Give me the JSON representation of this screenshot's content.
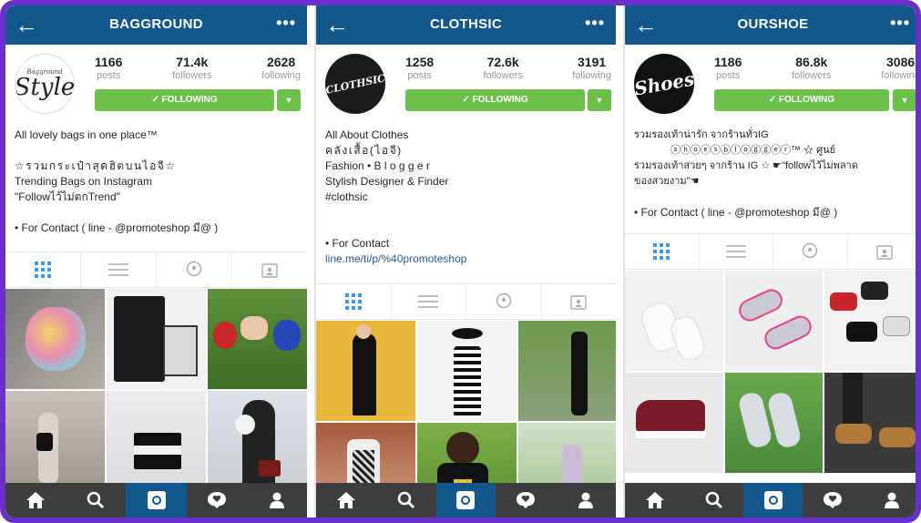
{
  "profiles": [
    {
      "title": "BAGGROUND",
      "posts": "1166",
      "posts_label": "posts",
      "followers": "71.4k",
      "followers_label": "followers",
      "following": "2628",
      "following_label": "following",
      "follow_button": "✓ FOLLOWING",
      "avatar_small": "Bagground",
      "avatar_text": "Style",
      "bio": [
        "All lovely bags in one place™",
        "",
        "☆รวมกระเป๋าสุดฮิตบนไอจี☆",
        "Trending Bags on Instagram",
        "\"Followไว้ไม่ตกTrend\"",
        "",
        "• For Contact ( line - @promoteshop มี@ )"
      ]
    },
    {
      "title": "CLOTHSIC",
      "posts": "1258",
      "posts_label": "posts",
      "followers": "72.6k",
      "followers_label": "followers",
      "following": "3191",
      "following_label": "following",
      "follow_button": "✓ FOLLOWING",
      "avatar_text": "CLOTHSIC",
      "bio": [
        "All About Clothes",
        "คลังเสื้อ(ไอจี)",
        "Fashion • B l o g g e r",
        "Stylish Designer & Finder",
        "#clothsic",
        "",
        "",
        "• For Contact"
      ],
      "bio_link": "line.me/ti/p/%40promoteshop"
    },
    {
      "title": "OURSHOE",
      "posts": "1186",
      "posts_label": "posts",
      "followers": "86.8k",
      "followers_label": "followers",
      "following": "3086",
      "following_label": "following",
      "follow_button": "✓ FOLLOWING",
      "avatar_text": "Shoes",
      "bio": [
        "รวมรองเท้าน่ารัก จากร้านทั่วIG",
        "ⓢⓗⓞⓔⓢⓑⓛⓞⓖⓖⓔⓡ™        ☆ ศูนย์",
        "รวมรองเท้าสวยๆ จากร้าน IG ☆      ☛\"followไว้ไม่พลาด",
        "ของสวยงาม\"☚",
        "",
        "• For Contact ( line - @promoteshop มี@ )"
      ]
    }
  ],
  "colors": {
    "header": "#12578c",
    "follow_green": "#6cc04a",
    "nav_bg": "#3d3d3d",
    "frame": "#6b2fc9"
  },
  "icons": [
    "back-arrow-icon",
    "more-dots-icon",
    "grid-icon",
    "list-icon",
    "location-pin-icon",
    "tagged-person-icon",
    "home-icon",
    "search-icon",
    "camera-icon",
    "activity-icon",
    "profile-icon"
  ]
}
